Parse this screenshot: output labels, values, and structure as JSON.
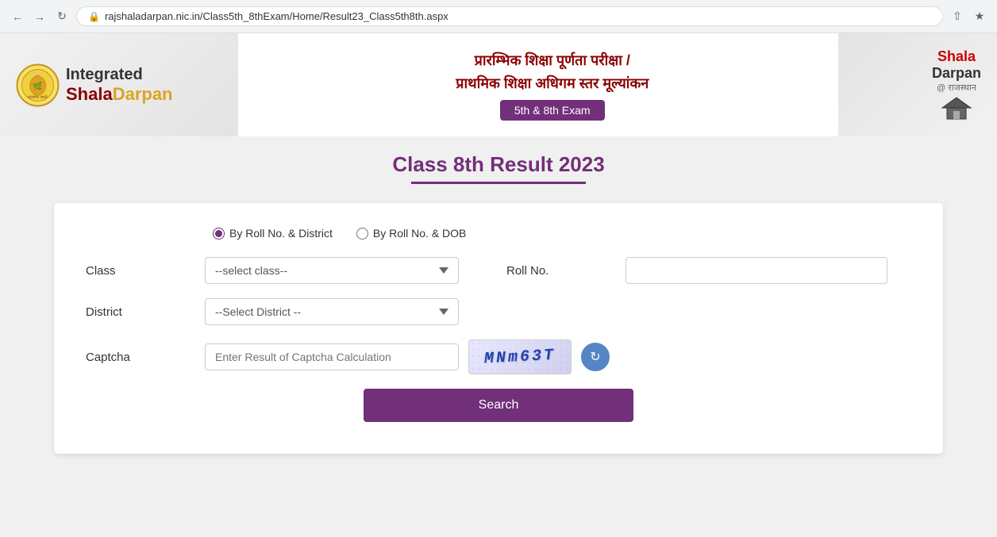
{
  "browser": {
    "url": "rajshaladarpan.nic.in/Class5th_8thExam/Home/Result23_Class5th8th.aspx"
  },
  "header": {
    "logo_integrated": "Integrated",
    "logo_shala": "Shala",
    "logo_darpan": "Darpan",
    "hindi_line1": "प्रारम्भिक शिक्षा पूर्णता परीक्षा /",
    "hindi_line2": "प्राथमिक शिक्षा अधिगम स्तर मूल्यांकन",
    "exam_badge": "5th & 8th Exam",
    "right_logo_line1": "Shala",
    "right_logo_line2": "Darpan",
    "right_logo_sub": "@ राजस्थान"
  },
  "page": {
    "title": "Class 8th Result 2023"
  },
  "form": {
    "radio_option1": "By Roll No. & District",
    "radio_option2": "By Roll No. & DOB",
    "class_label": "Class",
    "class_placeholder": "--select class--",
    "district_label": "District",
    "district_placeholder": "--Select District --",
    "rollno_label": "Roll No.",
    "captcha_label": "Captcha",
    "captcha_placeholder": "Enter Result of Captcha Calculation",
    "captcha_display": "MNm63T",
    "search_button": "Search"
  }
}
